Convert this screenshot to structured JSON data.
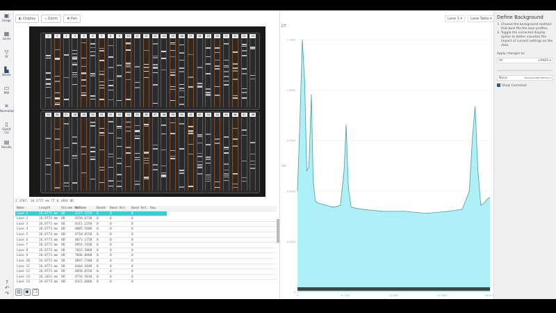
{
  "sidebar": {
    "items": [
      {
        "label": "Image",
        "icon": "image-icon"
      },
      {
        "label": "Lanes",
        "icon": "lanes-icon"
      },
      {
        "label": "Rf",
        "icon": "rf-icon"
      },
      {
        "label": "Bands",
        "icon": "bands-icon"
      },
      {
        "label": "MW",
        "icon": "mw-icon"
      },
      {
        "label": "Normalize",
        "icon": "normalize-icon"
      },
      {
        "label": "Quant Cal",
        "icon": "quant-cal-icon"
      },
      {
        "label": "Results",
        "icon": "results-icon"
      }
    ],
    "help": "?",
    "undo": "↶",
    "redo": "↷"
  },
  "toolbar": {
    "display": "Display",
    "zoom": "Zoom",
    "pan": "Pan"
  },
  "gel": {
    "top_lanes": [
      "1",
      "2",
      "3",
      "4",
      "5",
      "6",
      "7",
      "8",
      "9",
      "10",
      "11",
      "12",
      "13",
      "14",
      "15",
      "16",
      "17",
      "18",
      "19",
      "20",
      "21",
      "22",
      "23",
      "24"
    ],
    "bottom_lanes": [
      "25",
      "26",
      "27",
      "28",
      "29",
      "30",
      "31",
      "32",
      "33",
      "34",
      "35",
      "36",
      "37",
      "38",
      "39",
      "40",
      "41",
      "42",
      "43",
      "44",
      "45",
      "46",
      "47",
      "48"
    ]
  },
  "status": "2.3787, 18.3727 mm  CT 0.3464 OD",
  "table": {
    "headers": [
      "Name",
      "Length",
      "Volume Unit",
      "Volume",
      "Bands",
      "Band Vol.",
      "Band Vol. Raw"
    ],
    "rows": [
      [
        "Lane 1",
        "26.8773 mm",
        "OD",
        "4327.3358",
        "0",
        "0",
        "0"
      ],
      [
        "Lane 2",
        "26.8773 mm",
        "OD",
        "8258.6728",
        "0",
        "0",
        "0"
      ],
      [
        "Lane 3",
        "26.8773 mm",
        "OD",
        "8311.1358",
        "0",
        "0",
        "0"
      ],
      [
        "Lane 4",
        "26.8773 mm",
        "OD",
        "8005.5688",
        "0",
        "0",
        "0"
      ],
      [
        "Lane 5",
        "26.8773 mm",
        "OD",
        "8718.0558",
        "0",
        "0",
        "0"
      ],
      [
        "Lane 6",
        "26.8773 mm",
        "OD",
        "8873.1758",
        "0",
        "0",
        "0"
      ],
      [
        "Lane 7",
        "26.8773 mm",
        "OD",
        "8954.1938",
        "0",
        "0",
        "0"
      ],
      [
        "Lane 8",
        "26.8773 mm",
        "OD",
        "7824.5868",
        "0",
        "0",
        "0"
      ],
      [
        "Lane 9",
        "26.8773 mm",
        "OD",
        "7896.8868",
        "0",
        "0",
        "0"
      ],
      [
        "Lane 10",
        "26.8773 mm",
        "OD",
        "8897.7208",
        "0",
        "0",
        "0"
      ],
      [
        "Lane 11",
        "26.8773 mm",
        "OD",
        "8484.3648",
        "0",
        "0",
        "0"
      ],
      [
        "Lane 12",
        "26.8773 mm",
        "OD",
        "8058.0558",
        "0",
        "0",
        "0"
      ],
      [
        "Lane 13",
        "26.2013 mm",
        "OD",
        "6734.5818",
        "0",
        "0",
        "0"
      ],
      [
        "Lane 14",
        "26.8773 mm",
        "OD",
        "8322.6868",
        "0",
        "0",
        "0"
      ]
    ]
  },
  "chart_header": {
    "lane_select": "Lane 1",
    "view_select": "Lane Table",
    "corner_label": "CT"
  },
  "chart_data": {
    "type": "area",
    "xlabel": "Position (mm)",
    "ylabel": "OD",
    "xlim": [
      0,
      26.8773
    ],
    "ylim": [
      0,
      1.25
    ],
    "xticks": [
      "0",
      "6.7193",
      "13.4387",
      "20.1580",
      "26.8773"
    ],
    "yticks": [
      "0",
      "0.2500",
      "0.5000",
      "0.7500",
      "1.0000",
      "1.2500"
    ],
    "grid": true,
    "color": "#aef0f7",
    "x": [
      0,
      0.3,
      0.68,
      1.0,
      1.3,
      1.6,
      1.94,
      2.2,
      2.5,
      3,
      4,
      5,
      6,
      6.5,
      6.8,
      7.1,
      7.5,
      9,
      12,
      15,
      18,
      21,
      23,
      24,
      24.4,
      24.8,
      25.2,
      25.6,
      26,
      26.5,
      26.8773
    ],
    "values": [
      0.5,
      0.8,
      1.25,
      1.05,
      0.6,
      0.62,
      0.98,
      0.55,
      0.45,
      0.44,
      0.43,
      0.42,
      0.43,
      0.6,
      0.83,
      0.52,
      0.42,
      0.41,
      0.4,
      0.4,
      0.39,
      0.4,
      0.41,
      0.5,
      0.75,
      0.92,
      0.6,
      0.43,
      0.44,
      0.46,
      0.47
    ]
  },
  "right_panel": {
    "title": "Define Background",
    "steps": [
      "Choose the background method that best fits the lane profiles.",
      "Toggle the corrected display option to better visualize the impact of current settings on the data."
    ],
    "apply_label": "Apply changes to:",
    "apply_value": "All",
    "apply_unit": "LANES",
    "method_value": "None",
    "method_label": "BACKGROUND METHOD",
    "show_corrected": "Show Corrected"
  }
}
